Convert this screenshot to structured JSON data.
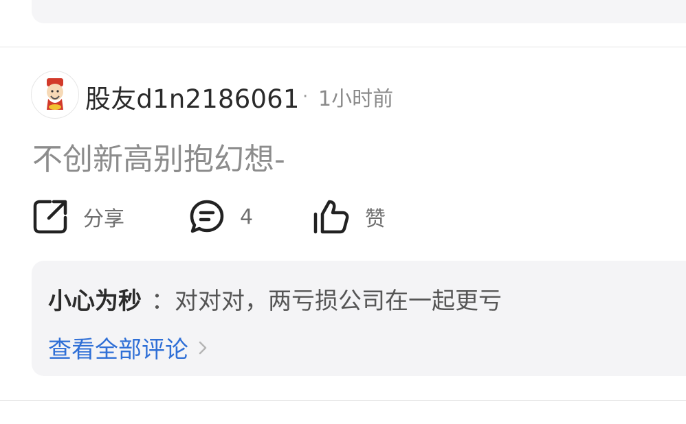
{
  "post": {
    "username": "股友d1n2186061",
    "separator": "·",
    "time": "1小时前",
    "content": "不创新高别抱幻想-"
  },
  "actions": {
    "share_label": "分享",
    "comment_count": "4",
    "like_label": "赞"
  },
  "comments": {
    "author": "小心为秒",
    "text": "：对对对，两亏损公司在一起更亏",
    "view_all": "查看全部评论"
  },
  "icons": {
    "share": "share-icon",
    "comment": "comment-icon",
    "like": "thumbs-up-icon",
    "chevron": "chevron-right-icon"
  },
  "colors": {
    "link": "#2f6fd6",
    "card_bg": "#f4f4f6"
  }
}
